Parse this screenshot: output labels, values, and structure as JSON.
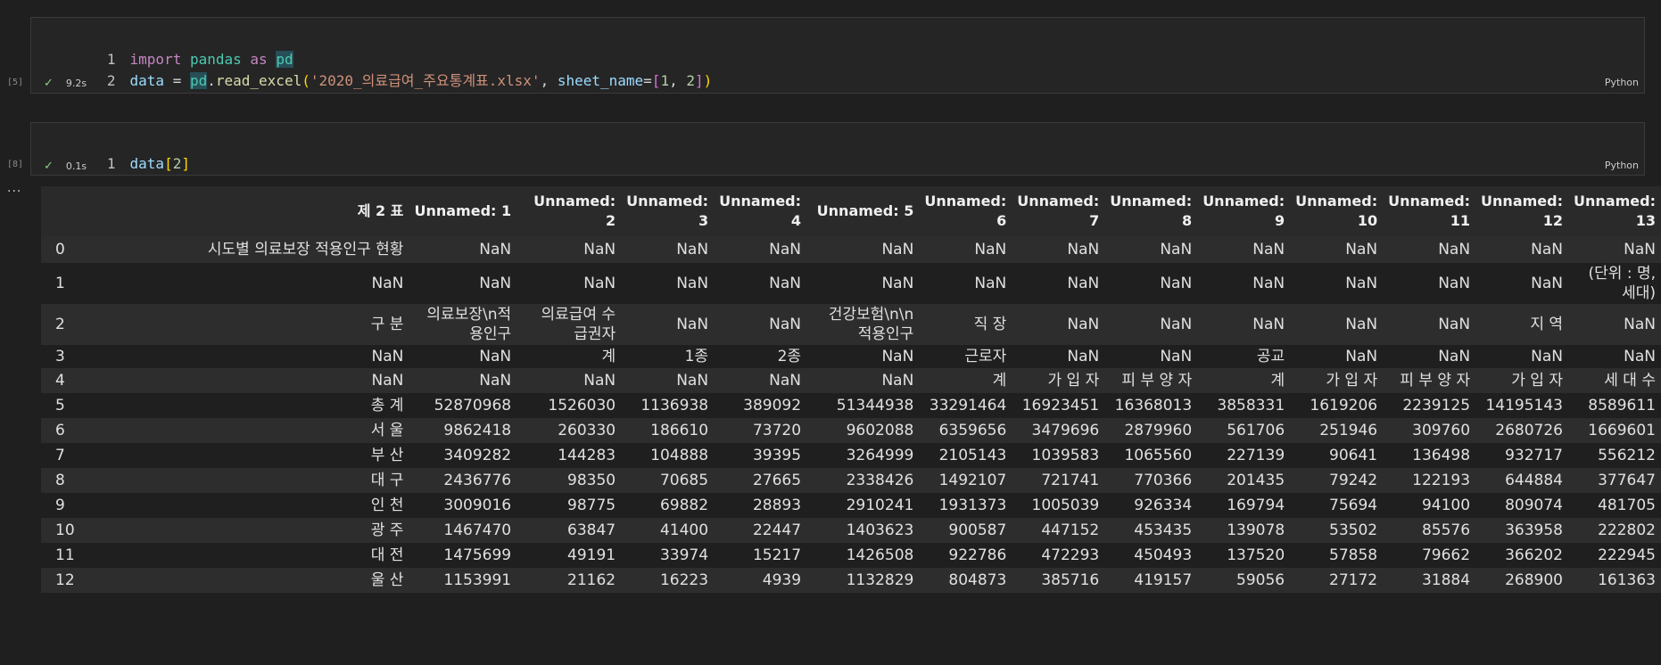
{
  "cells": [
    {
      "exec_count": "[5]",
      "line_numbers": [
        "1",
        "2"
      ],
      "code": {
        "l1_import": "import",
        "l1_pandas": "pandas",
        "l1_as": "as",
        "l1_pd": "pd",
        "l2_data": "data",
        "l2_eq": " = ",
        "l2_pd": "pd",
        "l2_dot": ".",
        "l2_fn": "read_excel",
        "l2_open": "(",
        "l2_str": "'2020_의료급여_주요통계표.xlsx'",
        "l2_comma": ", ",
        "l2_kw": "sheet_name",
        "l2_eq2": "=",
        "l2_lb": "[",
        "l2_n1": "1",
        "l2_sep": ", ",
        "l2_n2": "2",
        "l2_rb": "]",
        "l2_close": ")"
      },
      "status_icon": "check-icon",
      "time": "9.2s",
      "language": "Python"
    },
    {
      "exec_count": "[8]",
      "line_numbers": [
        "1"
      ],
      "code": {
        "l1_data": "data",
        "l1_lb": "[",
        "l1_n": "2",
        "l1_rb": "]"
      },
      "status_icon": "check-icon",
      "time": "0.1s",
      "language": "Python"
    }
  ],
  "output_menu": "...",
  "dataframe": {
    "columns": [
      "",
      "제 2 표",
      "Unnamed: 1",
      "Unnamed:\n2",
      "Unnamed:\n3",
      "Unnamed:\n4",
      "Unnamed: 5",
      "Unnamed:\n6",
      "Unnamed:\n7",
      "Unnamed:\n8",
      "Unnamed:\n9",
      "Unnamed:\n10",
      "Unnamed:\n11",
      "Unnamed:\n12",
      "Unnamed:\n13"
    ],
    "rows": [
      [
        "0",
        "시도별 의료보장 적용인구 현황",
        "NaN",
        "NaN",
        "NaN",
        "NaN",
        "NaN",
        "NaN",
        "NaN",
        "NaN",
        "NaN",
        "NaN",
        "NaN",
        "NaN",
        "NaN"
      ],
      [
        "1",
        "NaN",
        "NaN",
        "NaN",
        "NaN",
        "NaN",
        "NaN",
        "NaN",
        "NaN",
        "NaN",
        "NaN",
        "NaN",
        "NaN",
        "NaN",
        "(단위 : 명,\n세대)"
      ],
      [
        "2",
        "구 분",
        "의료보장\\n적\n용인구",
        "의료급여 수\n급권자",
        "NaN",
        "NaN",
        "건강보험\\n\\n\n적용인구",
        "직 장",
        "NaN",
        "NaN",
        "NaN",
        "NaN",
        "NaN",
        "지 역",
        "NaN"
      ],
      [
        "3",
        "NaN",
        "NaN",
        "계",
        "1종",
        "2종",
        "NaN",
        "근로자",
        "NaN",
        "NaN",
        "공교",
        "NaN",
        "NaN",
        "NaN",
        "NaN"
      ],
      [
        "4",
        "NaN",
        "NaN",
        "NaN",
        "NaN",
        "NaN",
        "NaN",
        "계",
        "가 입 자",
        "피 부 양 자",
        "계",
        "가 입 자",
        "피 부 양 자",
        "가 입 자",
        "세 대 수"
      ],
      [
        "5",
        "총 계",
        "52870968",
        "1526030",
        "1136938",
        "389092",
        "51344938",
        "33291464",
        "16923451",
        "16368013",
        "3858331",
        "1619206",
        "2239125",
        "14195143",
        "8589611"
      ],
      [
        "6",
        "서 울",
        "9862418",
        "260330",
        "186610",
        "73720",
        "9602088",
        "6359656",
        "3479696",
        "2879960",
        "561706",
        "251946",
        "309760",
        "2680726",
        "1669601"
      ],
      [
        "7",
        "부 산",
        "3409282",
        "144283",
        "104888",
        "39395",
        "3264999",
        "2105143",
        "1039583",
        "1065560",
        "227139",
        "90641",
        "136498",
        "932717",
        "556212"
      ],
      [
        "8",
        "대 구",
        "2436776",
        "98350",
        "70685",
        "27665",
        "2338426",
        "1492107",
        "721741",
        "770366",
        "201435",
        "79242",
        "122193",
        "644884",
        "377647"
      ],
      [
        "9",
        "인 천",
        "3009016",
        "98775",
        "69882",
        "28893",
        "2910241",
        "1931373",
        "1005039",
        "926334",
        "169794",
        "75694",
        "94100",
        "809074",
        "481705"
      ],
      [
        "10",
        "광 주",
        "1467470",
        "63847",
        "41400",
        "22447",
        "1403623",
        "900587",
        "447152",
        "453435",
        "139078",
        "53502",
        "85576",
        "363958",
        "222802"
      ],
      [
        "11",
        "대 전",
        "1475699",
        "49191",
        "33974",
        "15217",
        "1426508",
        "922786",
        "472293",
        "450493",
        "137520",
        "57858",
        "79662",
        "366202",
        "222945"
      ],
      [
        "12",
        "울 산",
        "1153991",
        "21162",
        "16223",
        "4939",
        "1132829",
        "804873",
        "385716",
        "419157",
        "59056",
        "27172",
        "31884",
        "268900",
        "161363"
      ]
    ]
  }
}
